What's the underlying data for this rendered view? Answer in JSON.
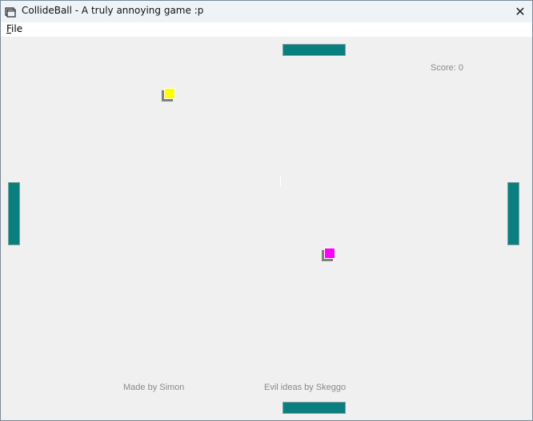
{
  "window": {
    "title": "CollideBall - A truly annoying game :p",
    "app_icon": "game-window-icon",
    "close_label": "✕"
  },
  "menubar": {
    "items": [
      {
        "label_mnemonic": "F",
        "label_rest": "ile"
      }
    ]
  },
  "game": {
    "score_text": "Score: 0",
    "credits": {
      "made_by": "Made by Simon",
      "evil_ideas": "Evil ideas by Skeggo"
    },
    "colors": {
      "paddle": "#0a7f7f",
      "ball_1": "#ffff00",
      "ball_2": "#ff00ff",
      "background": "#f0f0f0"
    }
  }
}
